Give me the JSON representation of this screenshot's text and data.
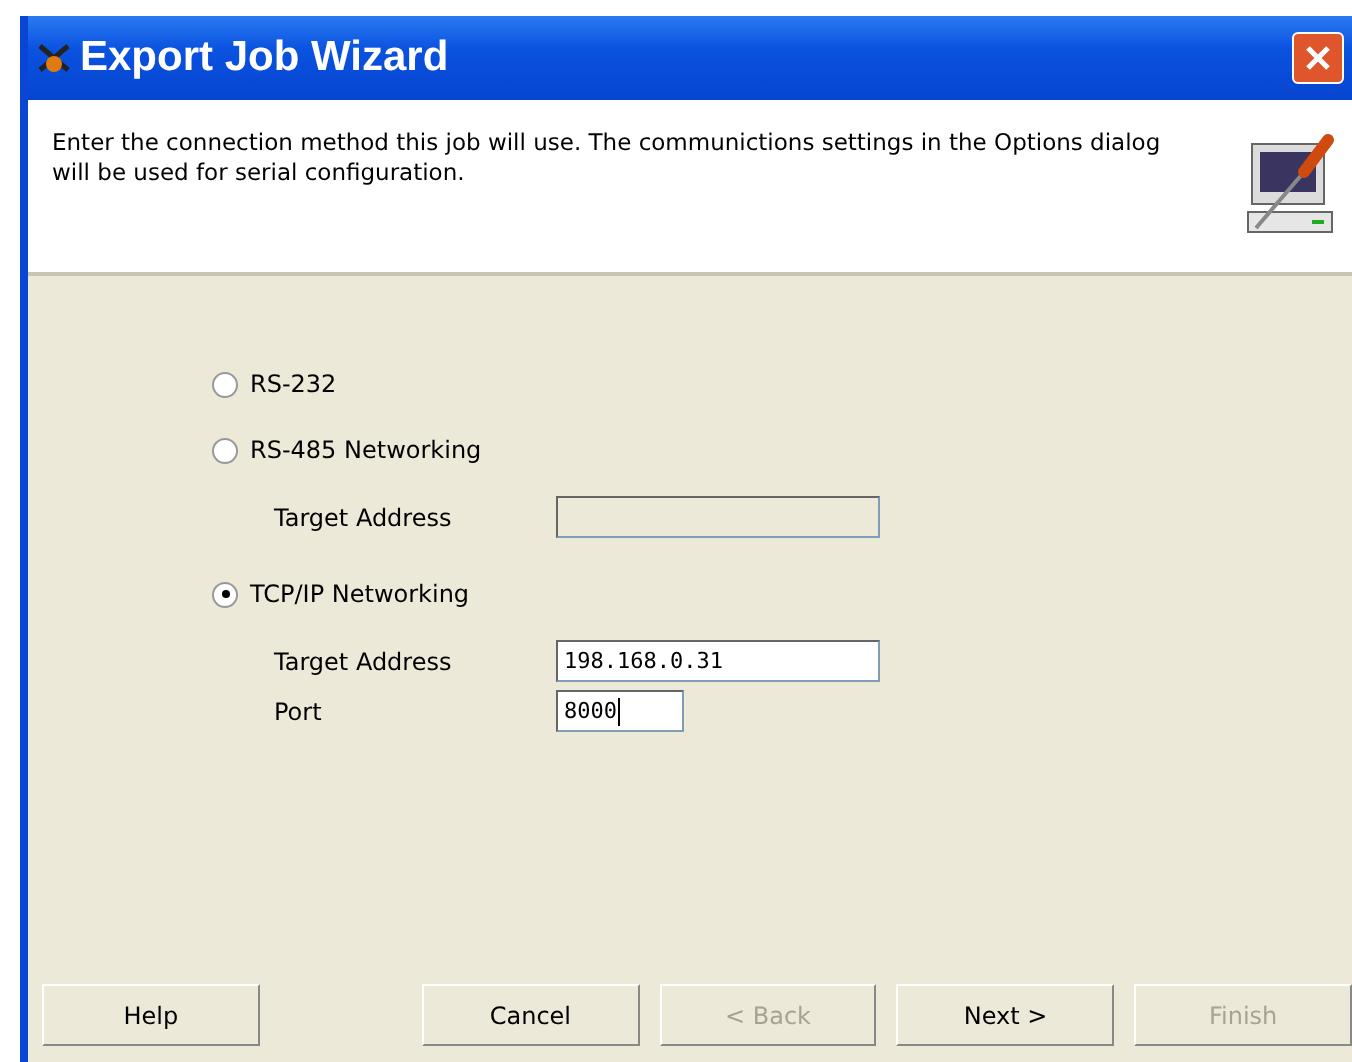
{
  "window": {
    "title": "Export Job Wizard"
  },
  "header": {
    "description": "Enter the connection method this job will use. The communictions settings in the Options dialog will be used for serial configuration."
  },
  "options": [
    {
      "label": "RS-232",
      "selected": false
    },
    {
      "label": "RS-485 Networking",
      "selected": false,
      "fields": [
        {
          "label": "Target Address",
          "disabled": true,
          "kind": "wide"
        }
      ]
    },
    {
      "label": "TCP/IP Networking",
      "selected": true,
      "fields": [
        {
          "label": "Target Address",
          "value": "198.168.0.31",
          "disabled": false,
          "kind": "wide"
        },
        {
          "label": "Port",
          "value": "8000",
          "disabled": false,
          "kind": "narrow",
          "focused": true
        }
      ]
    }
  ],
  "buttons": [
    {
      "label": "Help",
      "disabled": false
    },
    {
      "label": "Cancel",
      "disabled": false
    },
    {
      "label": "< Back",
      "disabled": true
    },
    {
      "label": "Next >",
      "disabled": false
    },
    {
      "label": "Finish",
      "disabled": true
    }
  ]
}
